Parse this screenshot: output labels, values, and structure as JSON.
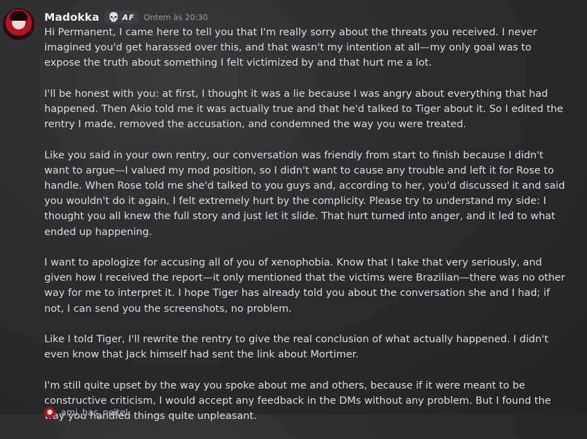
{
  "message": {
    "author": "Madokka",
    "tag": {
      "icon": "skull-icon",
      "text": "AF",
      "color": "#b67cf0"
    },
    "timestamp": "Ontem às 20:30",
    "paragraphs": [
      "Hi Permanent, I came here to tell you that I'm really sorry about the threats you received. I never imagined you'd get harassed over this, and that wasn't my intention at all—my only goal was to expose the truth about something I felt victimized by and that hurt me a lot.",
      "I'll be honest with you: at first, I thought it was a lie because I was angry about everything that had happened. Then Akio told me it was actually true and that he'd talked to Tiger about it. So I edited the rentry I made, removed the accusation, and condemned the way you were treated.",
      "Like you said in your own rentry, our conversation was friendly from start to finish because I didn't want to argue—I valued my mod position, so I didn't want to cause any trouble and left it for Rose to handle. When Rose told me she'd talked to you guys and, according to her, you'd discussed it and said you wouldn't do it again, I felt extremely hurt by the complicity. Please try to understand my side: I thought you all knew the full story and just let it slide. That hurt turned into anger, and it led to what ended up happening.",
      "I want to apologize for accusing all of you of xenophobia. Know that I take that very seriously, and given how I received the report—it only mentioned that the victims were Brazilian—there was no other way for me to interpret it. I hope Tiger has already told you about the conversation she and I had; if not, I can send you the screenshots, no problem.",
      "Like I told Tiger, I'll rewrite the rentry to give the real conclusion of what actually happened. I didn't even know that Jack himself had sent the link about Mortimer.",
      "I'm still quite upset by the way you spoke about me and others, because if it were meant to be constructive criticism, I would accept any feedback in the DMs without any problem. But I found the way you handled things quite unpleasant."
    ]
  },
  "next_reply": {
    "text": "ami_has_neitel"
  },
  "colors": {
    "background": "#2c2c2e",
    "text": "#dbdee1",
    "author": "#f2f3f5",
    "timestamp": "#949ba4"
  }
}
